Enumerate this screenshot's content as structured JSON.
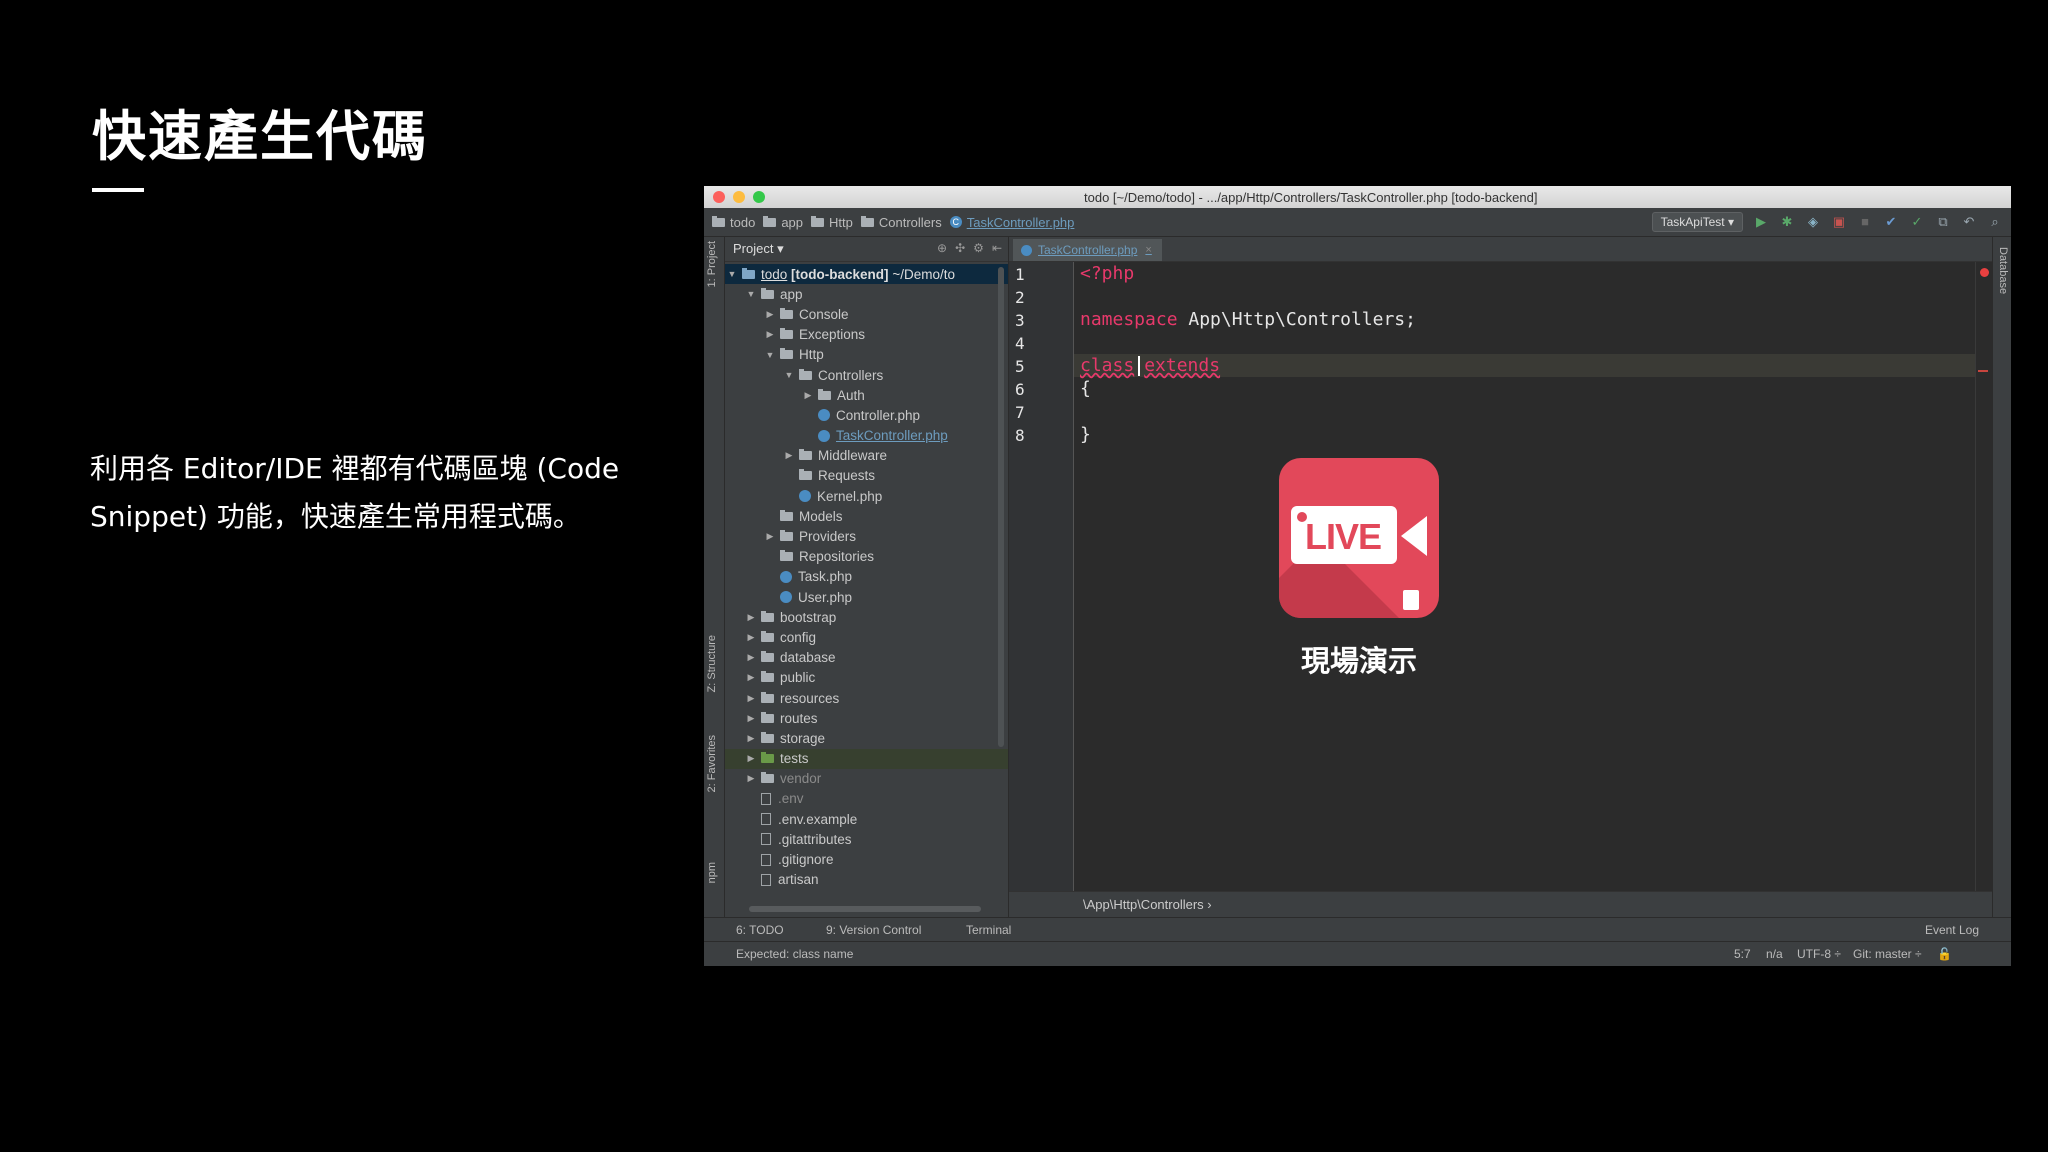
{
  "slide": {
    "title": "快速產生代碼",
    "body": "利用各 Editor/IDE 裡都有代碼區塊 (Code Snippet) 功能，快速產生常用程式碼。"
  },
  "window": {
    "title": "todo [~/Demo/todo] - .../app/Http/Controllers/TaskController.php [todo-backend]"
  },
  "navbar": {
    "crumbs": [
      "todo",
      "app",
      "Http",
      "Controllers",
      "TaskController.php"
    ],
    "run_config": "TaskApiTest ▾"
  },
  "sidebar": {
    "project_tab": "1: Project",
    "structure_tab": "Z: Structure",
    "favorites_tab": "2: Favorites",
    "npm_tab": "npm",
    "database_tab": "Database"
  },
  "project": {
    "header": "Project ▾",
    "root": {
      "name": "todo",
      "module": "[todo-backend]",
      "path": "~/Demo/to"
    },
    "tree": [
      {
        "label": "app",
        "depth": 1,
        "toggle": "▼",
        "icon": "folder"
      },
      {
        "label": "Console",
        "depth": 2,
        "toggle": "▶",
        "icon": "folder"
      },
      {
        "label": "Exceptions",
        "depth": 2,
        "toggle": "▶",
        "icon": "folder"
      },
      {
        "label": "Http",
        "depth": 2,
        "toggle": "▼",
        "icon": "folder"
      },
      {
        "label": "Controllers",
        "depth": 3,
        "toggle": "▼",
        "icon": "folder"
      },
      {
        "label": "Auth",
        "depth": 4,
        "toggle": "▶",
        "icon": "folder"
      },
      {
        "label": "Controller.php",
        "depth": 4,
        "toggle": "",
        "icon": "class"
      },
      {
        "label": "TaskController.php",
        "depth": 4,
        "toggle": "",
        "icon": "class",
        "style": "link"
      },
      {
        "label": "Middleware",
        "depth": 3,
        "toggle": "▶",
        "icon": "folder"
      },
      {
        "label": "Requests",
        "depth": 3,
        "toggle": "",
        "icon": "folder"
      },
      {
        "label": "Kernel.php",
        "depth": 3,
        "toggle": "",
        "icon": "class"
      },
      {
        "label": "Models",
        "depth": 2,
        "toggle": "",
        "icon": "folder"
      },
      {
        "label": "Providers",
        "depth": 2,
        "toggle": "▶",
        "icon": "folder"
      },
      {
        "label": "Repositories",
        "depth": 2,
        "toggle": "",
        "icon": "folder"
      },
      {
        "label": "Task.php",
        "depth": 2,
        "toggle": "",
        "icon": "class"
      },
      {
        "label": "User.php",
        "depth": 2,
        "toggle": "",
        "icon": "class"
      },
      {
        "label": "bootstrap",
        "depth": 1,
        "toggle": "▶",
        "icon": "folder"
      },
      {
        "label": "config",
        "depth": 1,
        "toggle": "▶",
        "icon": "folder"
      },
      {
        "label": "database",
        "depth": 1,
        "toggle": "▶",
        "icon": "folder"
      },
      {
        "label": "public",
        "depth": 1,
        "toggle": "▶",
        "icon": "folder"
      },
      {
        "label": "resources",
        "depth": 1,
        "toggle": "▶",
        "icon": "folder"
      },
      {
        "label": "routes",
        "depth": 1,
        "toggle": "▶",
        "icon": "folder"
      },
      {
        "label": "storage",
        "depth": 1,
        "toggle": "▶",
        "icon": "folder"
      },
      {
        "label": "tests",
        "depth": 1,
        "toggle": "▶",
        "icon": "folder-green",
        "style": "hl"
      },
      {
        "label": "vendor",
        "depth": 1,
        "toggle": "▶",
        "icon": "folder",
        "style": "dim"
      },
      {
        "label": ".env",
        "depth": 1,
        "toggle": "",
        "icon": "file",
        "style": "dim"
      },
      {
        "label": ".env.example",
        "depth": 1,
        "toggle": "",
        "icon": "file"
      },
      {
        "label": ".gitattributes",
        "depth": 1,
        "toggle": "",
        "icon": "file"
      },
      {
        "label": ".gitignore",
        "depth": 1,
        "toggle": "",
        "icon": "file"
      },
      {
        "label": "artisan",
        "depth": 1,
        "toggle": "",
        "icon": "file"
      }
    ]
  },
  "editor": {
    "tab_label": "TaskController.php",
    "line_numbers": [
      "1",
      "2",
      "3",
      "4",
      "5",
      "6",
      "7",
      "8"
    ],
    "code": {
      "l1": "<?php",
      "l3_kw": "namespace",
      "l3_rest": " App\\Http\\Controllers;",
      "l5_kw1": "class",
      "l5_kw2": "extends",
      "l6": "{",
      "l8": "}"
    },
    "breadcrumb": "\\App\\Http\\Controllers  ›"
  },
  "live": {
    "badge_text": "LIVE",
    "label": "現場演示"
  },
  "toolwindows": {
    "todo": "6: TODO",
    "vcs": "9: Version Control",
    "terminal": "Terminal",
    "event_log": "Event Log"
  },
  "status": {
    "message": "Expected: class name",
    "position": "5:7",
    "na": "n/a",
    "encoding": "UTF-8 ÷",
    "git": "Git: master ÷"
  },
  "colors": {
    "keyword": "#e8396b",
    "live_badge": "#e2485a",
    "ide_bg": "#3c3f41",
    "editor_bg": "#2b2b2b"
  }
}
